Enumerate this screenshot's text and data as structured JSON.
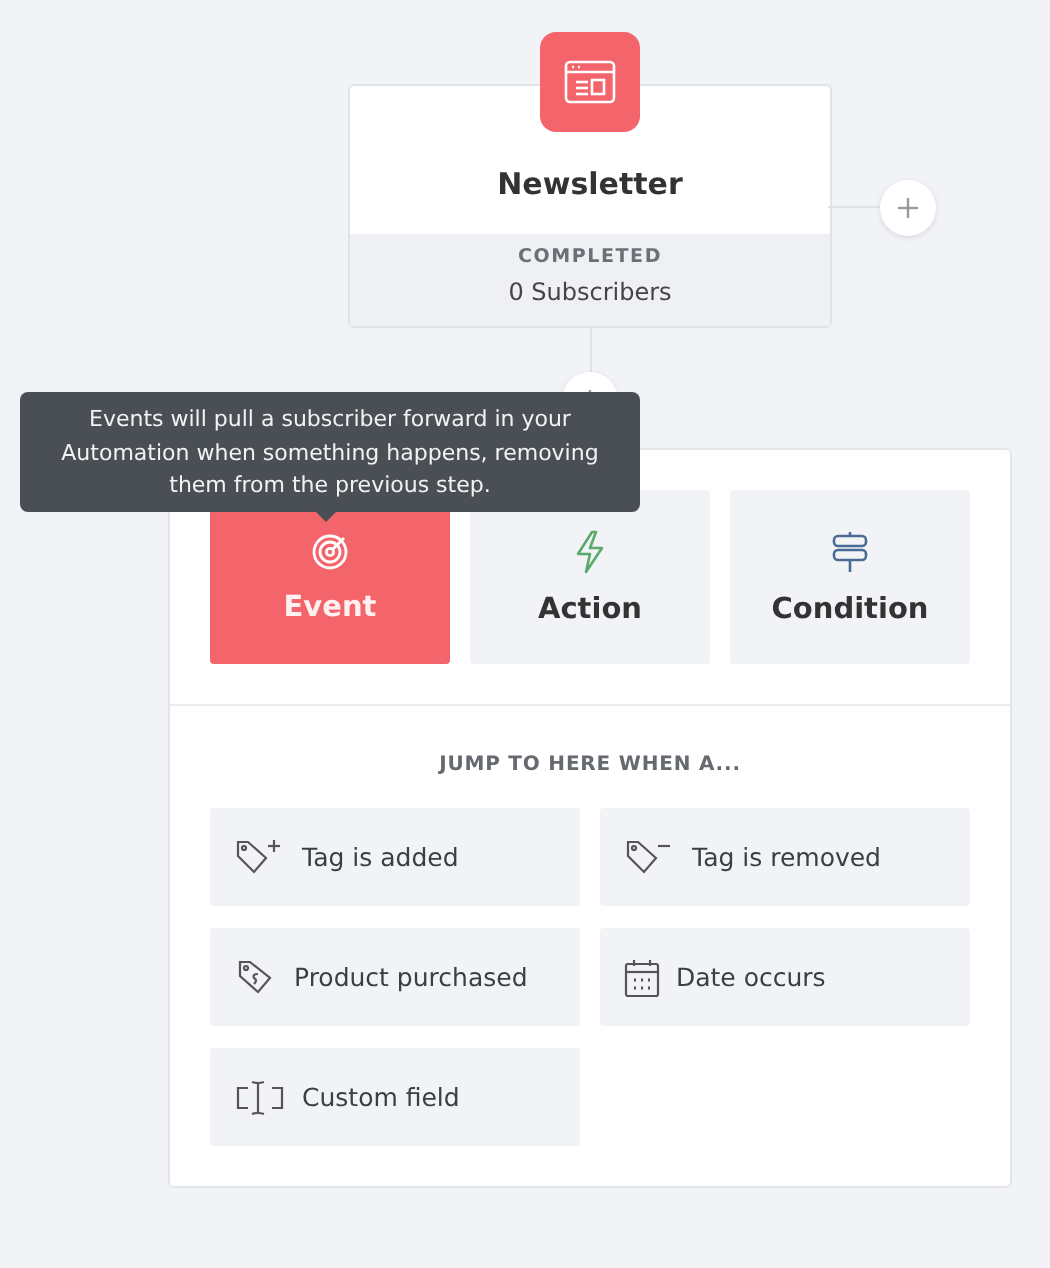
{
  "node": {
    "title": "Newsletter",
    "status": "COMPLETED",
    "count": "0 Subscribers"
  },
  "tooltip": {
    "text": "Events will pull a subscriber forward in your Automation when something happens, removing them from the previous step."
  },
  "tabs": [
    {
      "label": "Event",
      "selected": true
    },
    {
      "label": "Action",
      "selected": false
    },
    {
      "label": "Condition",
      "selected": false
    }
  ],
  "heading": "JUMP TO HERE WHEN A...",
  "options": [
    {
      "label": "Tag is added"
    },
    {
      "label": "Tag is removed"
    },
    {
      "label": "Product purchased"
    },
    {
      "label": "Date occurs"
    },
    {
      "label": "Custom field"
    }
  ]
}
